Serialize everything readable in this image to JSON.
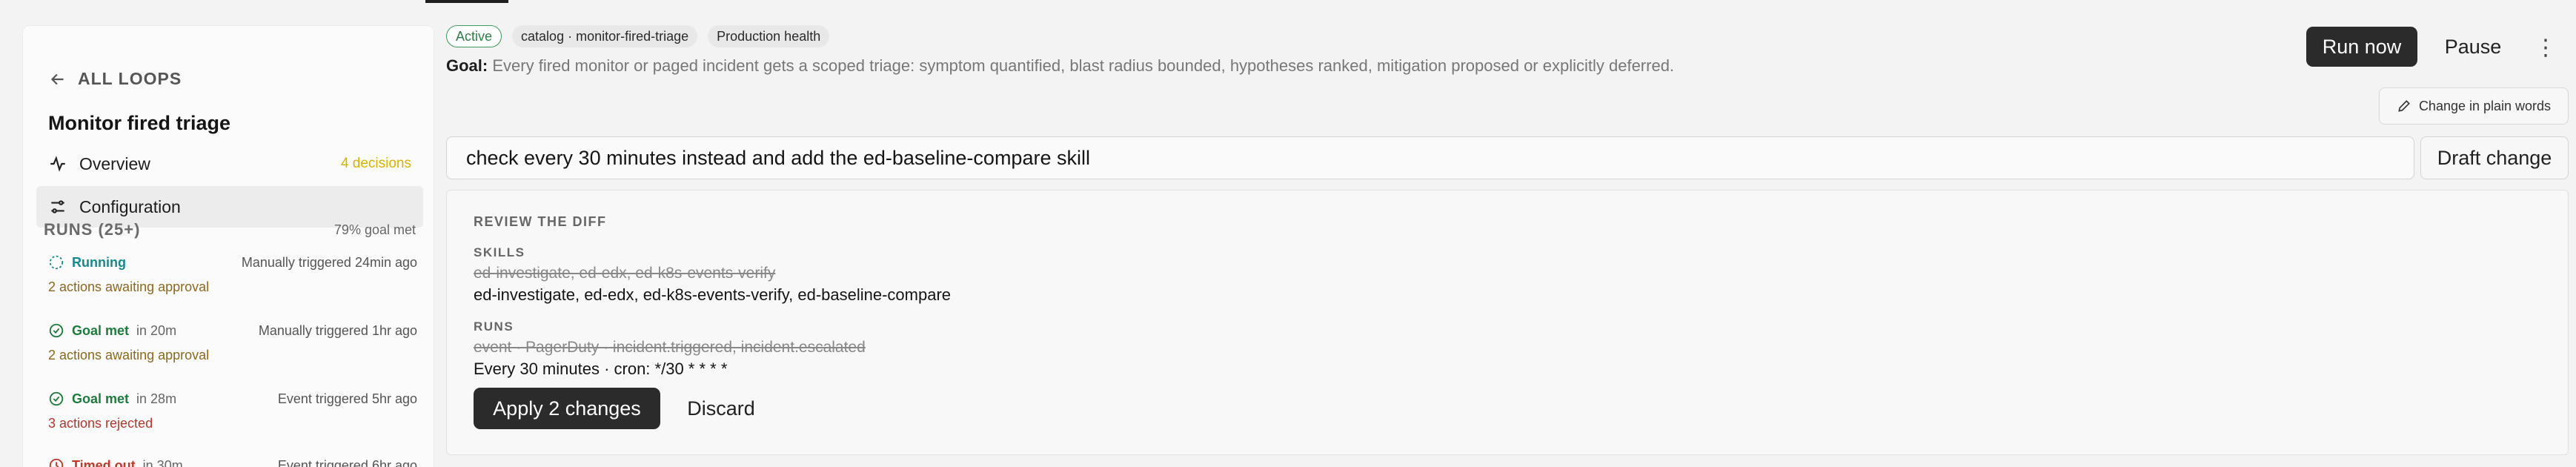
{
  "sidebar": {
    "back_label": "ALL LOOPS",
    "loop_title": "Monitor fired triage",
    "nav": {
      "overview": {
        "label": "Overview",
        "badge": "4 decisions"
      },
      "configuration": {
        "label": "Configuration"
      }
    },
    "runs_title": "RUNS (25+)",
    "runs_goal": "79% goal met",
    "runs": [
      {
        "status": "Running",
        "duration": "",
        "trigger": "Manually triggered 24min ago",
        "detail": "2 actions awaiting approval"
      },
      {
        "status": "Goal met",
        "duration": "in 20m",
        "trigger": "Manually triggered 1hr ago",
        "detail": "2 actions awaiting approval"
      },
      {
        "status": "Goal met",
        "duration": "in 28m",
        "trigger": "Event triggered 5hr ago",
        "detail": "3 actions rejected"
      },
      {
        "status": "Timed out",
        "duration": "in 30m",
        "trigger": "Event triggered 6hr ago",
        "detail": ""
      }
    ]
  },
  "header": {
    "pills": [
      "Active",
      "catalog · monitor-fired-triage",
      "Production health"
    ],
    "goal_label": "Goal:",
    "goal_text": "Every fired monitor or paged incident gets a scoped triage: symptom quantified, blast radius bounded, hypotheses ranked, mitigation proposed or explicitly deferred.",
    "run_now": "Run now",
    "pause": "Pause",
    "more": "⋮"
  },
  "change_plain": "Change in plain words",
  "command": {
    "value": "check every 30 minutes instead and add the ed-baseline-compare skill",
    "draft_label": "Draft change"
  },
  "diff": {
    "title": "REVIEW THE DIFF",
    "skills": {
      "label": "SKILLS",
      "old": "ed-investigate, ed-edx, ed-k8s-events-verify",
      "new": "ed-investigate, ed-edx, ed-k8s-events-verify, ed-baseline-compare"
    },
    "runs": {
      "label": "RUNS",
      "old": "event · PagerDuty · incident.triggered, incident.escalated",
      "new": "Every 30 minutes · cron: */30 * * * *"
    },
    "apply_label": "Apply 2 changes",
    "discard_label": "Discard"
  }
}
